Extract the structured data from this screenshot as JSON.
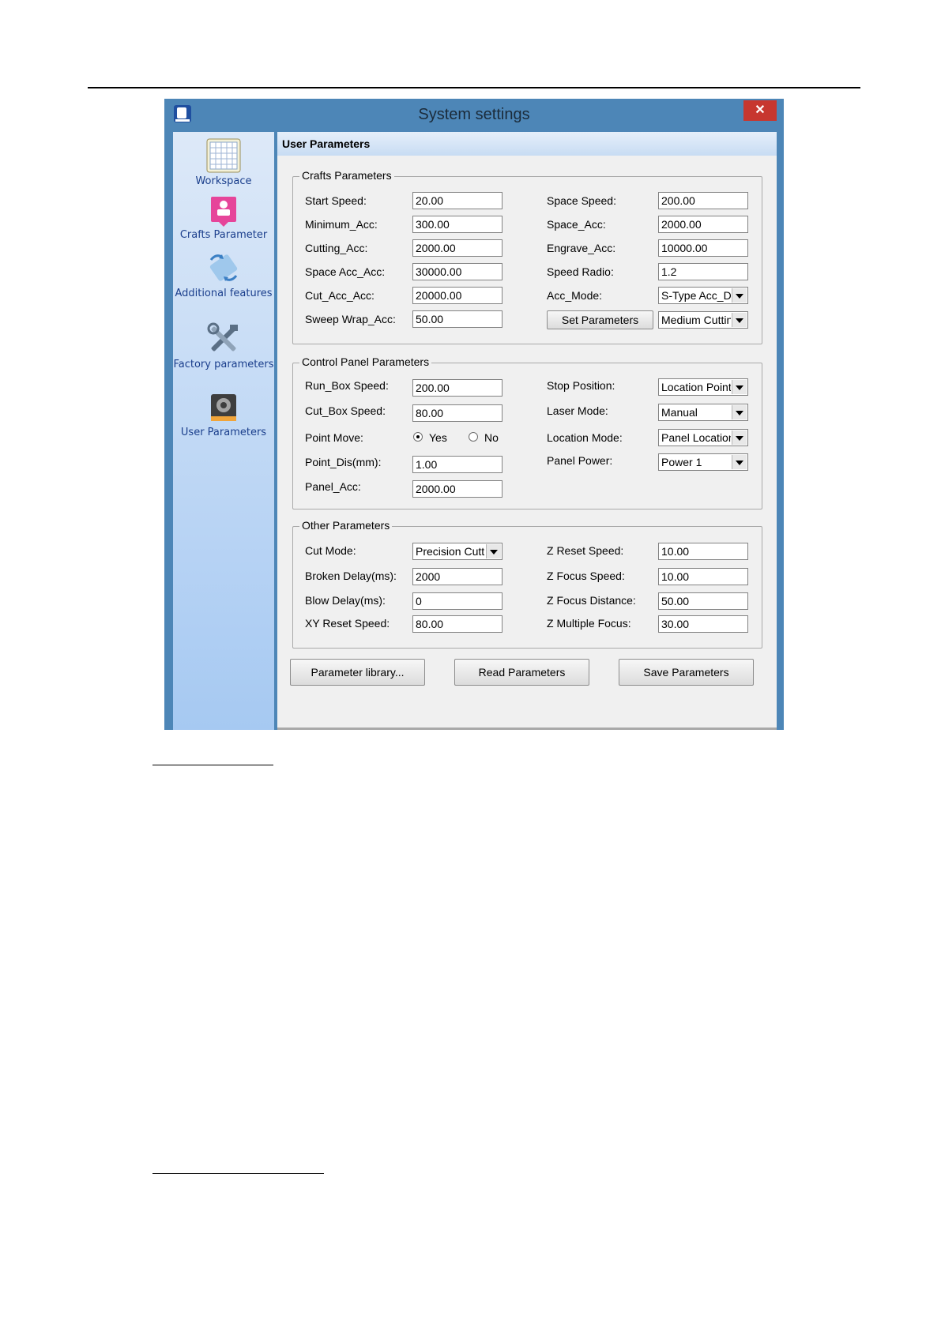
{
  "window": {
    "title": "System settings",
    "close_glyph": "✕"
  },
  "sidebar": {
    "items": [
      {
        "label": "Workspace",
        "icon": "workspace-grid-icon"
      },
      {
        "label": "Crafts Parameter",
        "icon": "crafts-parameter-icon"
      },
      {
        "label": "Additional features",
        "icon": "additional-features-icon"
      },
      {
        "label": "Factory parameters",
        "icon": "factory-tools-icon"
      },
      {
        "label": "User Parameters",
        "icon": "user-parameters-gear-icon",
        "active": true
      }
    ]
  },
  "header": {
    "title": "User Parameters"
  },
  "crafts": {
    "legend": "Crafts Parameters",
    "start_speed": {
      "label": "Start Speed:",
      "value": "20.00"
    },
    "minimum_acc": {
      "label": "Minimum_Acc:",
      "value": "300.00"
    },
    "cutting_acc": {
      "label": "Cutting_Acc:",
      "value": "2000.00"
    },
    "space_acc_acc": {
      "label": "Space Acc_Acc:",
      "value": "30000.00"
    },
    "cut_acc_acc": {
      "label": "Cut_Acc_Acc:",
      "value": "20000.00"
    },
    "sweep_wrap_acc": {
      "label": "Sweep Wrap_Acc:",
      "value": "50.00"
    },
    "space_speed": {
      "label": "Space Speed:",
      "value": "200.00"
    },
    "space_acc": {
      "label": "Space_Acc:",
      "value": "2000.00"
    },
    "engrave_acc": {
      "label": "Engrave_Acc:",
      "value": "10000.00"
    },
    "speed_radio": {
      "label": "Speed Radio:",
      "value": "1.2"
    },
    "acc_mode": {
      "label": "Acc_Mode:",
      "value": "S-Type Acc_D"
    },
    "set_parameters": "Set Parameters",
    "cutting_mode": {
      "value": "Medium Cutting"
    }
  },
  "control": {
    "legend": "Control Panel Parameters",
    "run_box_speed": {
      "label": "Run_Box Speed:",
      "value": "200.00"
    },
    "cut_box_speed": {
      "label": "Cut_Box Speed:",
      "value": "80.00"
    },
    "point_move": {
      "label": "Point Move:",
      "yes": "Yes",
      "no": "No",
      "selected": "Yes"
    },
    "point_dis": {
      "label": "Point_Dis(mm):",
      "value": "1.00"
    },
    "panel_acc": {
      "label": "Panel_Acc:",
      "value": "2000.00"
    },
    "stop_position": {
      "label": "Stop Position:",
      "value": "Location Point"
    },
    "laser_mode": {
      "label": "Laser Mode:",
      "value": "Manual"
    },
    "location_mode": {
      "label": "Location Mode:",
      "value": "Panel Location"
    },
    "panel_power": {
      "label": "Panel Power:",
      "value": "Power 1"
    }
  },
  "other": {
    "legend": "Other Parameters",
    "cut_mode": {
      "label": "Cut Mode:",
      "value": "Precision Cutting"
    },
    "broken_delay": {
      "label": "Broken Delay(ms):",
      "value": "2000"
    },
    "blow_delay": {
      "label": "Blow Delay(ms):",
      "value": "0"
    },
    "xy_reset_speed": {
      "label": "XY Reset Speed:",
      "value": "80.00"
    },
    "z_reset_speed": {
      "label": "Z Reset Speed:",
      "value": "10.00"
    },
    "z_focus_speed": {
      "label": "Z Focus Speed:",
      "value": "10.00"
    },
    "z_focus_distance": {
      "label": "Z Focus Distance:",
      "value": "50.00"
    },
    "z_multiple_focus": {
      "label": "Z Multiple Focus:",
      "value": "30.00"
    }
  },
  "buttons": {
    "parameter_library": "Parameter library...",
    "read_parameters": "Read Parameters",
    "save_parameters": "Save Parameters"
  }
}
